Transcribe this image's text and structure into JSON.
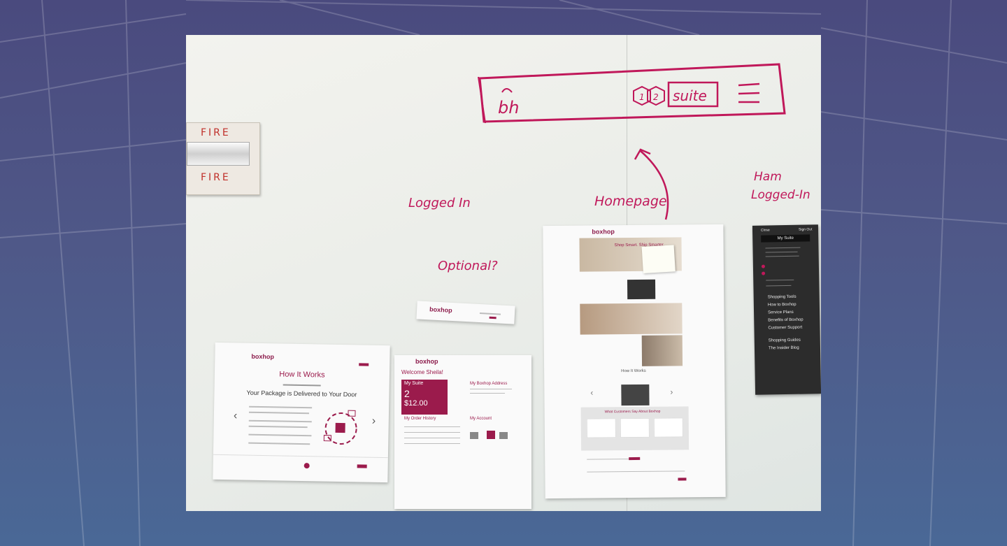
{
  "whiteboard": {
    "fire_alarm": {
      "top_label": "FIRE",
      "bottom_label": "FIRE"
    },
    "header_sketch": {
      "logo": "bh",
      "badge_1": "1",
      "badge_2": "2",
      "suite_label": "suite"
    },
    "annotations": {
      "logged_in": "Logged In",
      "optional": "Optional?",
      "homepage": "Homepage",
      "ham_logged_in_line1": "Ham",
      "ham_logged_in_line2": "Logged-In",
      "question_1": "?",
      "question_2": "?"
    },
    "marker_color": "#c0185a"
  },
  "print_how_it_works": {
    "logo": "boxhop",
    "title": "How It Works",
    "subtitle": "Your Package is Delivered to Your Door",
    "prev_arrow": "‹",
    "next_arrow": "›"
  },
  "print_dashboard": {
    "logo": "boxhop",
    "welcome": "Welcome Sheila!",
    "suite_title": "My Suite",
    "package_count": "2",
    "price": "$12.00",
    "address_title": "My Boxhop Address",
    "order_history_title": "My Order History",
    "account_title": "My Account"
  },
  "print_homepage": {
    "logo": "boxhop",
    "hero_heading": "Shop Smart. Ship Smarter.",
    "how_it_works": "How It Works",
    "customers_heading": "What Customers Say About Boxhop",
    "prev_arrow": "‹",
    "next_arrow": "›"
  },
  "print_hamburger_menu": {
    "close_label": "Close",
    "sign_out_label": "Sign Out",
    "my_suite": "My Suite",
    "items": [
      "Shopping Tools",
      "How to Boxhop",
      "Service Plans",
      "Benefits of Boxhop",
      "Customer Support",
      "Shopping Guides",
      "The Insider Blog"
    ]
  },
  "print_optional_header": {
    "logo": "boxhop"
  },
  "colors": {
    "brand": "#9b1b4c",
    "background_top": "#4a4a7e",
    "background_bottom": "#4a6896"
  }
}
